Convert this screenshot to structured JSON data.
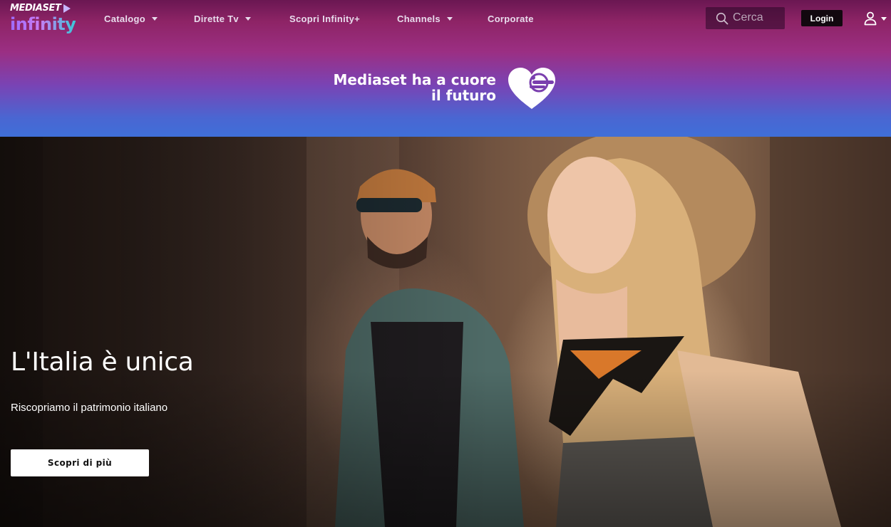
{
  "brand": {
    "top": "MEDIASET",
    "bottom": "infinity"
  },
  "nav": {
    "items": [
      {
        "label": "Catalogo",
        "has_dropdown": true
      },
      {
        "label": "Dirette Tv",
        "has_dropdown": true
      },
      {
        "label": "Scopri Infinity+",
        "has_dropdown": false
      },
      {
        "label": "Channels",
        "has_dropdown": true
      },
      {
        "label": "Corporate",
        "has_dropdown": false
      }
    ]
  },
  "search": {
    "placeholder": "Cerca",
    "value": "",
    "icon": "search-icon"
  },
  "login": {
    "label": "Login"
  },
  "user_menu": {
    "icon": "user-icon"
  },
  "promo": {
    "line1": "Mediaset ha a cuore",
    "line2": "il futuro",
    "icon": "heart-icon"
  },
  "hero": {
    "title": "L'Italia è unica",
    "subtitle": "Riscopriamo il patrimonio italiano",
    "cta_label": "Scopri di più"
  },
  "colors": {
    "header_gradient_top": "#6a1752",
    "header_gradient_mid": "#9b2f83",
    "header_gradient_bottom": "#3f6fd8",
    "login_bg": "#12080f",
    "cta_bg": "#ffffff"
  }
}
